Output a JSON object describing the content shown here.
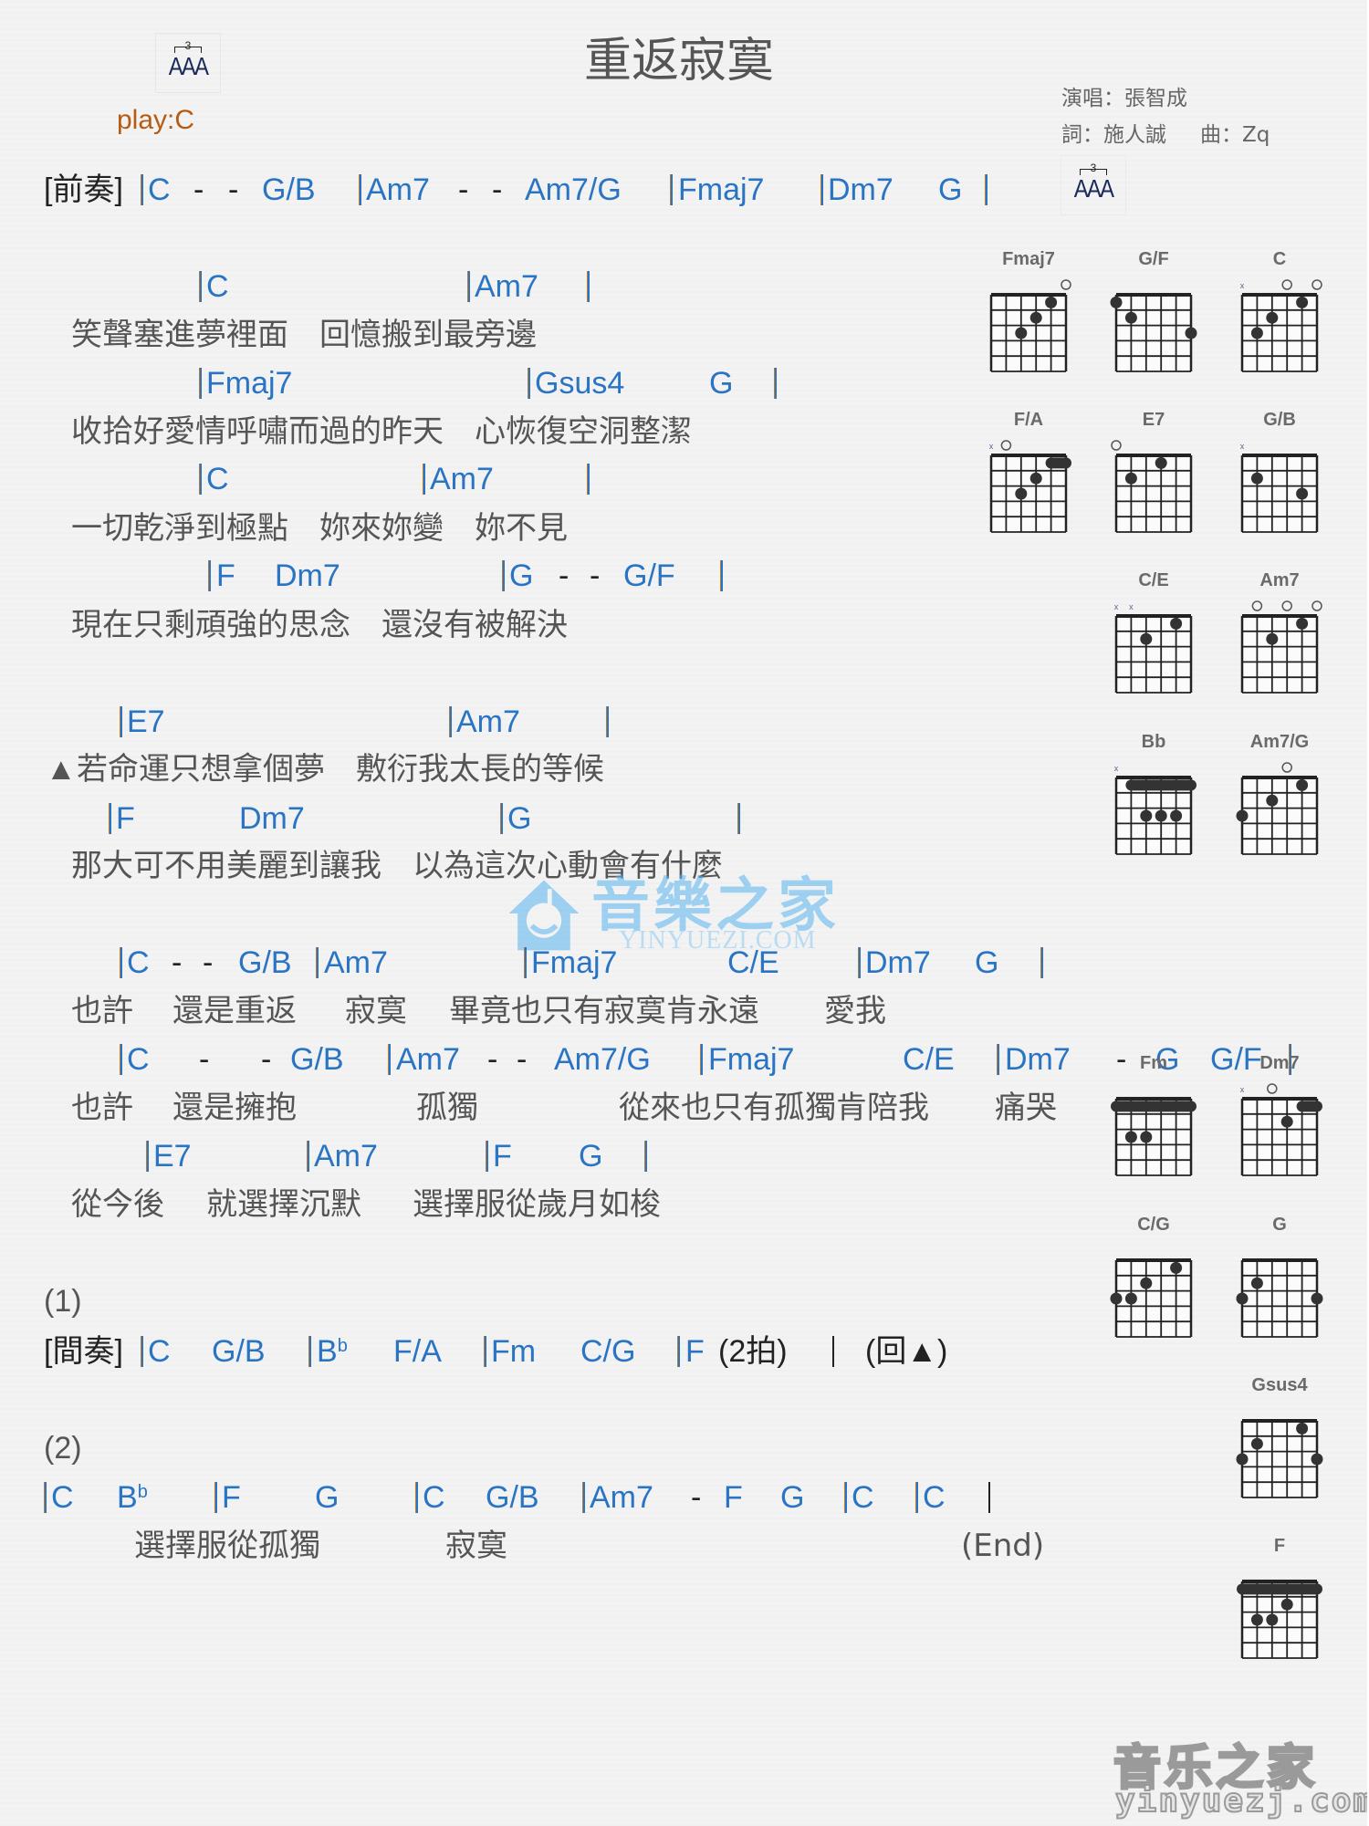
{
  "title": "重返寂寞",
  "play_key": "play:C",
  "credits": {
    "singer": "演唱：張智成",
    "lyricist": "詞：施人誠",
    "composer": "曲：Zq"
  },
  "strum_icon": {
    "tuplet": "3",
    "notes": "AAA",
    "icon": "triplet-strum-pattern-icon"
  },
  "colors": {
    "chord": "#2a74c4",
    "lyric": "#555555",
    "play": "#b85b12",
    "bar_accent": "#c07a2a"
  },
  "intro": {
    "label": "[前奏]",
    "tokens": [
      "C",
      "-",
      "-",
      "G/B",
      "Am7",
      "-",
      "-",
      "Am7/G",
      "Fmaj7",
      "Dm7",
      "G"
    ]
  },
  "verse": [
    {
      "chords": [
        "C",
        "Am7"
      ],
      "lyric": "笑聲塞進夢裡面　回憶搬到最旁邊"
    },
    {
      "chords": [
        "Fmaj7",
        "Gsus4",
        "G"
      ],
      "lyric": "收拾好愛情呼嘯而過的昨天　心恢復空洞整潔"
    },
    {
      "chords": [
        "C",
        "Am7"
      ],
      "lyric": "一切乾淨到極點　妳來妳變　妳不見"
    },
    {
      "chords": [
        "F",
        "Dm7",
        "G",
        "-",
        "-",
        "G/F"
      ],
      "lyric": "現在只剩頑強的思念　還沒有被解決"
    }
  ],
  "prechorus": [
    {
      "chords": [
        "E7",
        "Am7"
      ],
      "marker": "▲",
      "lyric": "若命運只想拿個夢　敷衍我太長的等候"
    },
    {
      "chords": [
        "F",
        "Dm7",
        "G"
      ],
      "lyric": "那大可不用美麗到讓我　以為這次心動會有什麼"
    }
  ],
  "chorus": [
    {
      "chords": [
        "C",
        "-",
        "-",
        "G/B",
        "Am7",
        "Fmaj7",
        "C/E",
        "Dm7",
        "G"
      ],
      "lyric_parts": [
        "也許",
        "還是重返",
        "寂寞",
        "畢竟也只有寂寞肯永遠",
        "愛我"
      ]
    },
    {
      "chords": [
        "C",
        "-",
        "-",
        "G/B",
        "Am7",
        "-",
        "-",
        "Am7/G",
        "Fmaj7",
        "C/E",
        "Dm7",
        "-",
        "G",
        "G/F"
      ],
      "lyric_parts": [
        "也許",
        "還是擁抱",
        "孤獨",
        "從來也只有孤獨肯陪我",
        "痛哭"
      ]
    },
    {
      "chords": [
        "E7",
        "Am7",
        "F",
        "G"
      ],
      "lyric_parts": [
        "從今後",
        "就選擇沉默",
        "選擇服從歲月如梭"
      ]
    }
  ],
  "ending1": {
    "label": "(1)",
    "interlude_label": "[間奏]",
    "chords": [
      "C",
      "G/B",
      "B",
      "b",
      "F/A",
      "Fm",
      "C/G",
      "F"
    ],
    "beats_note": "(2拍)",
    "return_note": "(回▲)"
  },
  "ending2": {
    "label": "(2)",
    "chords": [
      "C",
      "B",
      "b",
      "F",
      "G",
      "C",
      "G/B",
      "Am7",
      "-",
      "F",
      "G",
      "C",
      "C"
    ],
    "lyric_parts": [
      "選擇服從孤獨",
      "寂寞"
    ],
    "end_label": "(End)"
  },
  "chord_diagrams": [
    {
      "name": "Fmaj7",
      "open": [
        6
      ],
      "muted": [],
      "barres": [],
      "dots": [
        [
          5,
          1
        ],
        [
          4,
          2
        ],
        [
          3,
          3
        ]
      ]
    },
    {
      "name": "G/F",
      "open": [],
      "muted": [],
      "barres": [],
      "dots": [
        [
          1,
          1
        ],
        [
          2,
          2
        ],
        [
          6,
          3
        ]
      ]
    },
    {
      "name": "C",
      "open": [
        4,
        6
      ],
      "muted": [
        1
      ],
      "barres": [],
      "dots": [
        [
          5,
          1
        ],
        [
          3,
          2
        ],
        [
          2,
          3
        ]
      ]
    },
    {
      "name": "F/A",
      "open": [
        2
      ],
      "muted": [
        1
      ],
      "barres": [
        [
          1,
          5,
          6
        ]
      ],
      "dots": [
        [
          4,
          2
        ],
        [
          3,
          3
        ]
      ]
    },
    {
      "name": "E7",
      "open": [
        1
      ],
      "muted": [],
      "barres": [],
      "dots": [
        [
          4,
          1
        ],
        [
          2,
          2
        ]
      ]
    },
    {
      "name": "G/B",
      "open": [],
      "muted": [
        1
      ],
      "barres": [],
      "dots": [
        [
          2,
          2
        ],
        [
          5,
          3
        ]
      ]
    },
    {
      "name": "C/E",
      "open": [],
      "muted": [
        1,
        2
      ],
      "barres": [],
      "dots": [
        [
          5,
          1
        ],
        [
          3,
          2
        ]
      ]
    },
    {
      "name": "Am7",
      "open": [
        2,
        4,
        6
      ],
      "muted": [],
      "barres": [],
      "dots": [
        [
          5,
          1
        ],
        [
          3,
          2
        ]
      ]
    },
    {
      "name": "Bb",
      "open": [],
      "muted": [
        1
      ],
      "barres": [
        [
          1,
          2,
          6
        ]
      ],
      "dots": [
        [
          3,
          3
        ],
        [
          4,
          3
        ],
        [
          5,
          3
        ]
      ]
    },
    {
      "name": "Am7/G",
      "open": [
        4
      ],
      "muted": [],
      "barres": [],
      "dots": [
        [
          5,
          1
        ],
        [
          3,
          2
        ],
        [
          1,
          3
        ]
      ]
    },
    {
      "name": "Fm",
      "open": [],
      "muted": [],
      "barres": [
        [
          1,
          1,
          6
        ]
      ],
      "dots": [
        [
          2,
          3
        ],
        [
          3,
          3
        ]
      ]
    },
    {
      "name": "Dm7",
      "open": [
        3
      ],
      "muted": [
        1
      ],
      "barres": [
        [
          1,
          5,
          6
        ]
      ],
      "dots": [
        [
          4,
          2
        ]
      ]
    },
    {
      "name": "C/G",
      "open": [],
      "muted": [],
      "barres": [],
      "dots": [
        [
          5,
          1
        ],
        [
          3,
          2
        ],
        [
          1,
          3
        ],
        [
          2,
          3
        ]
      ]
    },
    {
      "name": "G",
      "open": [],
      "muted": [],
      "barres": [],
      "dots": [
        [
          2,
          2
        ],
        [
          1,
          3
        ],
        [
          6,
          3
        ]
      ]
    },
    {
      "name": "Gsus4",
      "open": [],
      "muted": [],
      "barres": [],
      "dots": [
        [
          5,
          1
        ],
        [
          2,
          2
        ],
        [
          1,
          3
        ],
        [
          6,
          3
        ]
      ]
    },
    {
      "name": "F",
      "open": [],
      "muted": [],
      "barres": [
        [
          1,
          1,
          6
        ]
      ],
      "dots": [
        [
          4,
          2
        ],
        [
          2,
          3
        ],
        [
          3,
          3
        ]
      ]
    }
  ],
  "watermarks": {
    "center_cn": "音樂之家",
    "center_url": "YINYUEZI.COM",
    "corner_cn": "音乐之家",
    "corner_url": "yinyuezj.com"
  }
}
